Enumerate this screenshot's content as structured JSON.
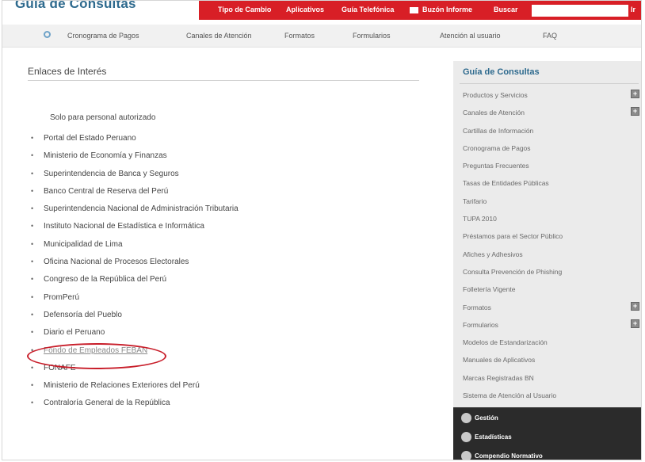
{
  "site": {
    "title": "Guía de Consultas"
  },
  "topnav": {
    "items": [
      "Tipo de Cambio",
      "Aplicativos",
      "Guía Telefónica",
      "Buzón Informe",
      "Buscar"
    ],
    "search_placeholder": "",
    "search_button": "Ir"
  },
  "subnav": {
    "items": [
      "Cronograma de Pagos",
      "Canales de Atención",
      "Formatos",
      "Formularios",
      "Atención al usuario",
      "FAQ"
    ]
  },
  "main": {
    "title": "Enlaces de Interés",
    "auth_note": "Solo para personal autorizado",
    "links": [
      "Portal del Estado Peruano",
      "Ministerio de Economía y Finanzas",
      "Superintendencia de Banca y Seguros",
      "Banco Central de Reserva del Perú",
      "Superintendencia Nacional de Administración Tributaria",
      "Instituto Nacional de Estadística e Informática",
      "Municipalidad de Lima",
      "Oficina Nacional de Procesos Electorales",
      "Congreso de la República del Perú",
      "PromPerú",
      "Defensoría del Pueblo",
      "Diario el Peruano",
      "Fondo de Empleados FEBAN",
      "FONAFE",
      "Ministerio de Relaciones Exteriores del Perú",
      "Contraloría General de la República"
    ],
    "highlighted_link": "Fondo de Empleados FEBAN"
  },
  "sidebar": {
    "title": "Guía de Consultas",
    "items": [
      {
        "label": "Productos y Servicios",
        "expandable": true
      },
      {
        "label": "Canales de Atención",
        "expandable": true
      },
      {
        "label": "Cartillas de Información",
        "expandable": false
      },
      {
        "label": "Cronograma de Pagos",
        "expandable": false
      },
      {
        "label": "Preguntas Frecuentes",
        "expandable": false
      },
      {
        "label": "Tasas de Entidades Públicas",
        "expandable": false
      },
      {
        "label": "Tarifario",
        "expandable": false
      },
      {
        "label": "TUPA 2010",
        "expandable": false
      },
      {
        "label": "Préstamos para el Sector Público",
        "expandable": false
      },
      {
        "label": "Afiches y Adhesivos",
        "expandable": false
      },
      {
        "label": "Consulta Prevención de Phishing",
        "expandable": false
      },
      {
        "label": "Folletería Vigente",
        "expandable": false
      },
      {
        "label": "Formatos",
        "expandable": true
      },
      {
        "label": "Formularios",
        "expandable": true
      },
      {
        "label": "Modelos de Estandarización",
        "expandable": false
      },
      {
        "label": "Manuales de Aplicativos",
        "expandable": false
      },
      {
        "label": "Marcas Registradas BN",
        "expandable": false
      },
      {
        "label": "Sistema de Atención al Usuario",
        "expandable": false
      }
    ],
    "expand_glyph": "+"
  },
  "bottom_panel": {
    "items": [
      "Gestión",
      "Estadísticas",
      "Compendio Normativo"
    ]
  },
  "colors": {
    "brand_red": "#d81f26",
    "brand_blue": "#2e6a8e",
    "highlight_ellipse": "#c81e2a",
    "dark_panel": "#2b2b2b"
  }
}
